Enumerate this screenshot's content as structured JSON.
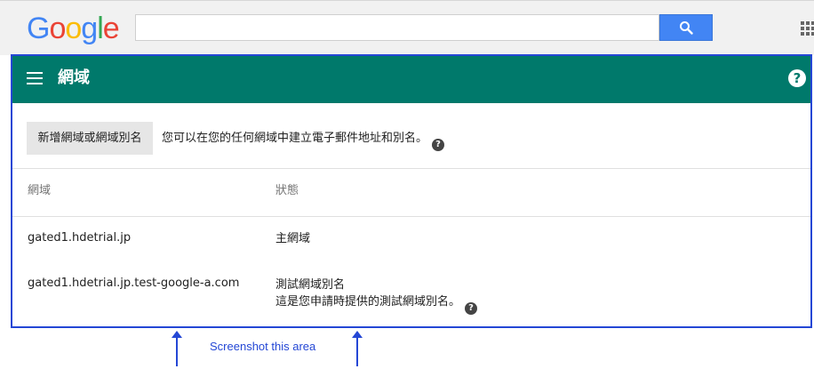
{
  "google_bar": {
    "logo_letters": [
      {
        "char": "G",
        "color": "#4285f4"
      },
      {
        "char": "o",
        "color": "#ea4335"
      },
      {
        "char": "o",
        "color": "#fbbc05"
      },
      {
        "char": "g",
        "color": "#4285f4"
      },
      {
        "char": "l",
        "color": "#34a853"
      },
      {
        "char": "e",
        "color": "#ea4335"
      }
    ],
    "search_value": "",
    "search_icon": "search-icon",
    "apps_icon": "apps-grid-icon"
  },
  "header": {
    "title": "網域",
    "background": "#00796b",
    "menu_icon": "hamburger-menu-icon",
    "help_icon": "help-icon",
    "help_glyph": "?"
  },
  "toolbar": {
    "add_button": "新增網域或網域別名",
    "intro_text": "您可以在您的任何網域中建立電子郵件地址和別名。",
    "help_glyph": "?"
  },
  "table": {
    "columns": [
      "網域",
      "狀態"
    ],
    "rows": [
      {
        "domain": "gated1.hdetrial.jp",
        "status": "主網域",
        "note": ""
      },
      {
        "domain": "gated1.hdetrial.jp.test-google-a.com",
        "status": "測試網域別名",
        "note": "這是您申請時提供的測試網域別名。"
      }
    ]
  },
  "annotation": {
    "text": "Screenshot this area",
    "color": "#2447d5"
  }
}
